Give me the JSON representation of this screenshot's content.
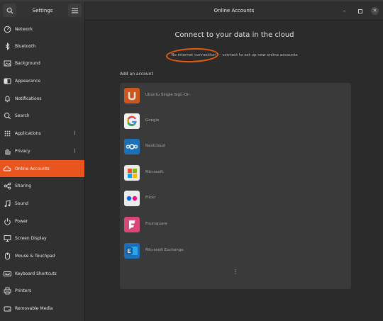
{
  "app": {
    "settings_title": "Settings",
    "window_title": "Online Accounts"
  },
  "sidebar": {
    "items": [
      {
        "label": "Network",
        "icon": "network-icon",
        "chevron": ""
      },
      {
        "label": "Bluetooth",
        "icon": "bluetooth-icon",
        "chevron": ""
      },
      {
        "label": "Background",
        "icon": "background-icon",
        "chevron": ""
      },
      {
        "label": "Appearance",
        "icon": "appearance-icon",
        "chevron": ""
      },
      {
        "label": "Notifications",
        "icon": "bell-icon",
        "chevron": ""
      },
      {
        "label": "Search",
        "icon": "search-icon",
        "chevron": ""
      },
      {
        "label": "Applications",
        "icon": "grid-icon",
        "chevron": ")"
      },
      {
        "label": "Privacy",
        "icon": "hand-icon",
        "chevron": ")"
      },
      {
        "label": "Online Accounts",
        "icon": "cloud-icon",
        "chevron": "",
        "active": true
      },
      {
        "label": "Sharing",
        "icon": "share-icon",
        "chevron": ""
      },
      {
        "label": "Sound",
        "icon": "music-note-icon",
        "chevron": ""
      },
      {
        "label": "Power",
        "icon": "power-icon",
        "chevron": ""
      },
      {
        "label": "Screen Display",
        "icon": "display-icon",
        "chevron": ""
      },
      {
        "label": "Mouse & Touchpad",
        "icon": "mouse-icon",
        "chevron": ""
      },
      {
        "label": "Keyboard Shortcuts",
        "icon": "keyboard-icon",
        "chevron": ""
      },
      {
        "label": "Printers",
        "icon": "printer-icon",
        "chevron": ""
      },
      {
        "label": "Removable Media",
        "icon": "media-icon",
        "chevron": ""
      }
    ]
  },
  "main": {
    "headline": "Connect to your data in the cloud",
    "offline_note": "No internet connection — connect to set up new online accounts",
    "section_title": "Add an account",
    "providers": [
      {
        "label": "Ubuntu Single Sign-On",
        "icon": "ubuntu-sso-icon",
        "color": "#c9571f"
      },
      {
        "label": "Google",
        "icon": "google-icon",
        "color": "#f2f2f2"
      },
      {
        "label": "Nextcloud",
        "icon": "nextcloud-icon",
        "color": "#1e6fb5"
      },
      {
        "label": "Microsoft",
        "icon": "microsoft-icon",
        "color": "#e9e9e9"
      },
      {
        "label": "Flickr",
        "icon": "flickr-icon",
        "color": "#ececec"
      },
      {
        "label": "Foursquare",
        "icon": "foursquare-icon",
        "color": "#d8467a"
      },
      {
        "label": "Microsoft Exchange",
        "icon": "exchange-icon",
        "color": "#1c6fb8"
      }
    ],
    "more": "⋮"
  },
  "colors": {
    "accent": "#e9541f",
    "annotation": "#ea5b0c"
  }
}
